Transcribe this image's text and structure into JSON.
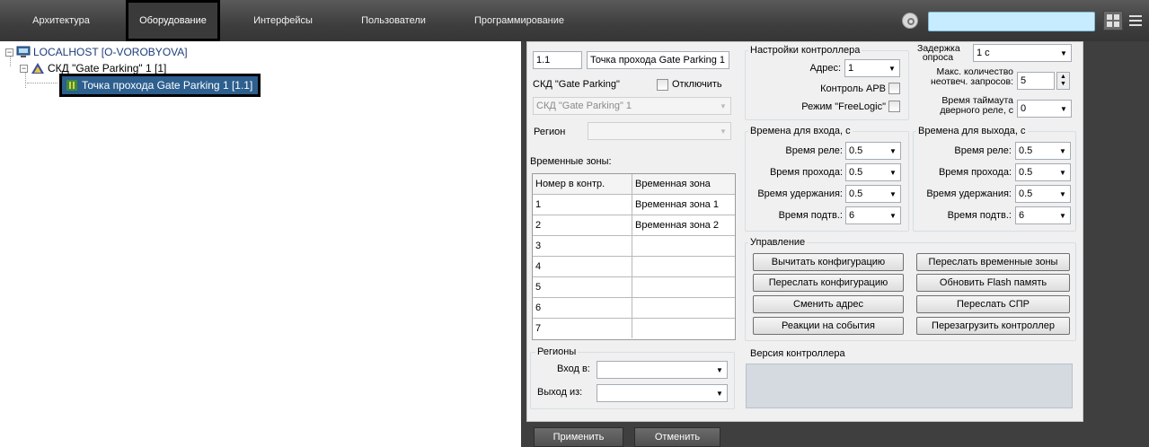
{
  "tabs": [
    "Архитектура",
    "Оборудование",
    "Интерфейсы",
    "Пользователи",
    "Программирование"
  ],
  "search": {
    "value": ""
  },
  "tree": {
    "root": "LOCALHOST [O-VOROBYOVA]",
    "skd": "СКД \"Gate Parking\" 1 [1]",
    "point": "Точка прохода Gate Parking 1 [1.1]"
  },
  "form": {
    "id_value": "1.1",
    "name_value": "Точка прохода Gate Parking 1",
    "skd_label": "СКД \"Gate Parking\"",
    "disable_label": "Отключить",
    "skd_combo": "СКД \"Gate Parking\" 1",
    "region_label": "Регион",
    "region_value": "",
    "tz_label": "Временные зоны:",
    "tz_headers": [
      "Номер в контр.",
      "Временная зона"
    ],
    "tz_rows": [
      [
        "1",
        "Временная зона 1"
      ],
      [
        "2",
        "Временная зона 2"
      ],
      [
        "3",
        ""
      ],
      [
        "4",
        ""
      ],
      [
        "5",
        ""
      ],
      [
        "6",
        ""
      ],
      [
        "7",
        ""
      ]
    ],
    "regions_group": "Регионы",
    "entry_label": "Вход в:",
    "exit_label": "Выход из:",
    "entry_value": "",
    "exit_value": ""
  },
  "controller": {
    "group": "Настройки контроллера",
    "address_label": "Адрес:",
    "address_value": "1",
    "apb_label": "Контроль АРВ",
    "freelogic_label": "Режим \"FreeLogic\"",
    "delay_label": "Задержка опроса",
    "delay_value": "1 с",
    "max_label": "Макс. количество неотвеч. запросов:",
    "max_value": "5",
    "timeout_label": "Время таймаута дверного реле, с",
    "timeout_value": "0"
  },
  "entry_times": {
    "group": "Времена для входа, с",
    "relay_label": "Время реле:",
    "relay_value": "0.5",
    "pass_label": "Время прохода:",
    "pass_value": "0.5",
    "hold_label": "Время удержания:",
    "hold_value": "0.5",
    "confirm_label": "Время подтв.:",
    "confirm_value": "6"
  },
  "exit_times": {
    "group": "Времена для выхода, с",
    "relay_label": "Время реле:",
    "relay_value": "0.5",
    "pass_label": "Время прохода:",
    "pass_value": "0.5",
    "hold_label": "Время удержания:",
    "hold_value": "0.5",
    "confirm_label": "Время подтв.:",
    "confirm_value": "6"
  },
  "management": {
    "group": "Управление",
    "read_config": "Вычитать конфигурацию",
    "send_tz": "Переслать временные зоны",
    "send_config": "Переслать конфигурацию",
    "update_flash": "Обновить Flash память",
    "change_address": "Сменить адрес",
    "send_spr": "Переслать СПР",
    "reactions": "Реакции на события",
    "reboot": "Перезагрузить контроллер"
  },
  "version": {
    "group": "Версия контроллера",
    "value": ""
  },
  "footer": {
    "apply": "Применить",
    "cancel": "Отменить"
  }
}
